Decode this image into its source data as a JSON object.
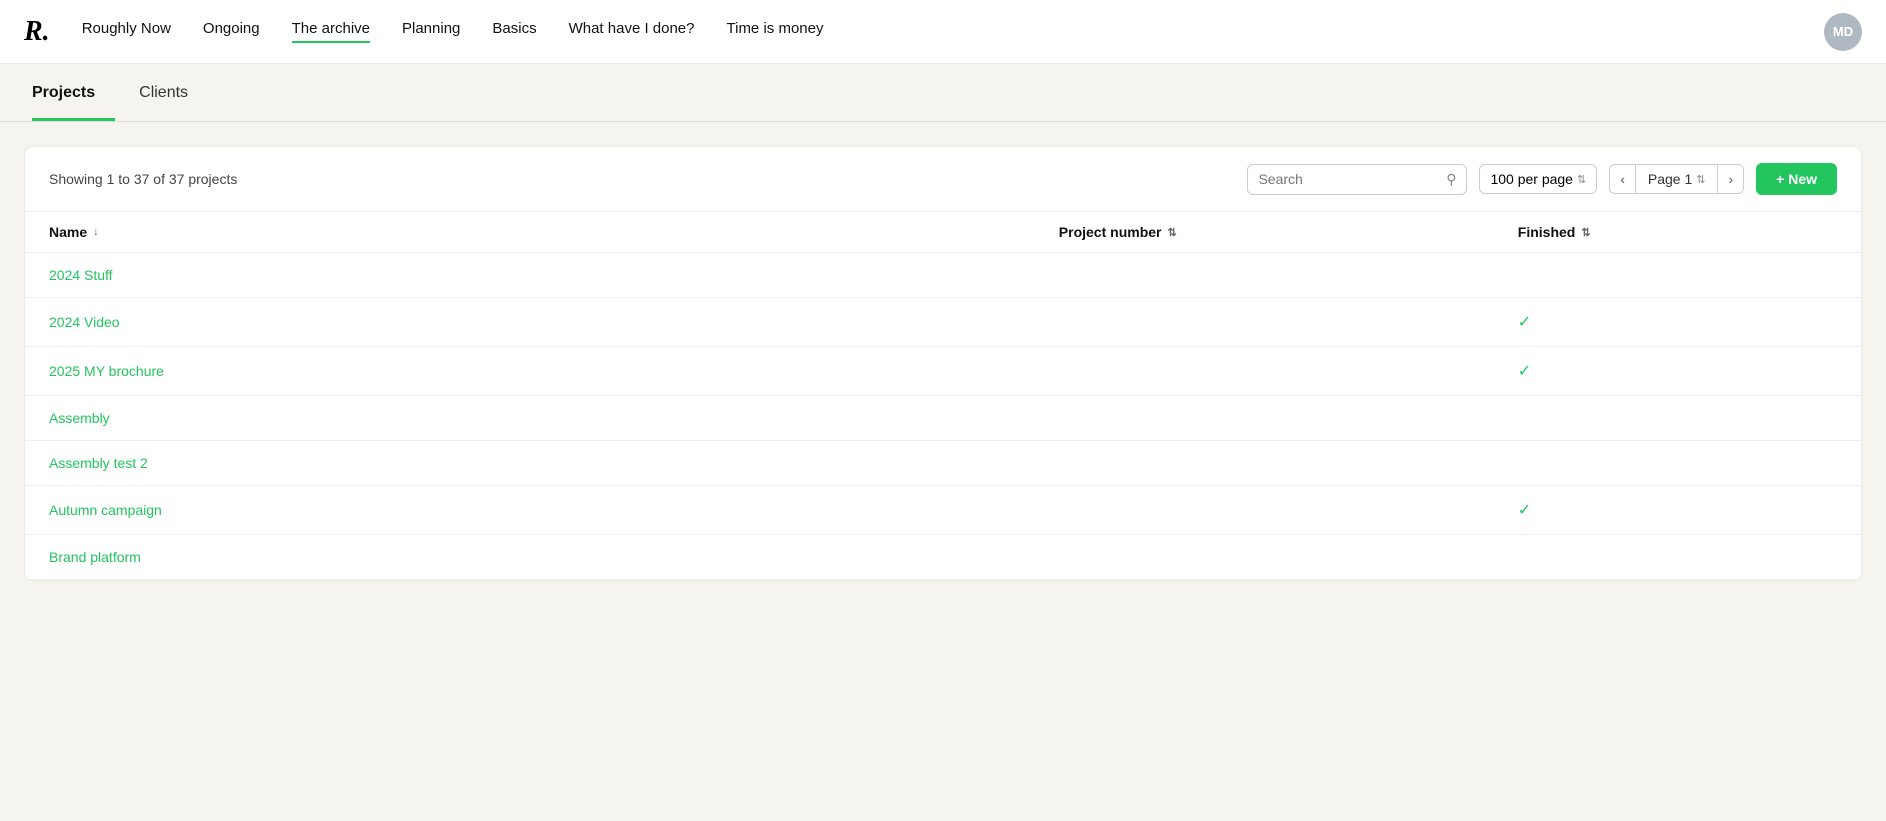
{
  "app": {
    "logo": "R.",
    "avatar_initials": "MD"
  },
  "nav": {
    "links": [
      {
        "label": "Roughly Now",
        "active": false
      },
      {
        "label": "Ongoing",
        "active": false
      },
      {
        "label": "The archive",
        "active": true
      },
      {
        "label": "Planning",
        "active": false
      },
      {
        "label": "Basics",
        "active": false
      },
      {
        "label": "What have I done?",
        "active": false
      },
      {
        "label": "Time is money",
        "active": false
      }
    ]
  },
  "sub_tabs": {
    "tabs": [
      {
        "label": "Projects",
        "active": true
      },
      {
        "label": "Clients",
        "active": false
      }
    ]
  },
  "toolbar": {
    "showing_text": "Showing 1 to 37 of 37 projects",
    "search_placeholder": "Search",
    "per_page_label": "100 per page",
    "page_label": "Page 1",
    "new_button_label": "+ New"
  },
  "table": {
    "columns": [
      {
        "key": "name",
        "label": "Name",
        "sortable": true
      },
      {
        "key": "project_number",
        "label": "Project number",
        "sortable": true
      },
      {
        "key": "finished",
        "label": "Finished",
        "sortable": true
      }
    ],
    "rows": [
      {
        "name": "2024 Stuff",
        "project_number": "",
        "finished": false
      },
      {
        "name": "2024 Video",
        "project_number": "",
        "finished": true
      },
      {
        "name": "2025 MY brochure",
        "project_number": "",
        "finished": true
      },
      {
        "name": "Assembly",
        "project_number": "",
        "finished": false
      },
      {
        "name": "Assembly test 2",
        "project_number": "",
        "finished": false
      },
      {
        "name": "Autumn campaign",
        "project_number": "",
        "finished": true
      },
      {
        "name": "Brand platform",
        "project_number": "",
        "finished": false
      }
    ]
  }
}
